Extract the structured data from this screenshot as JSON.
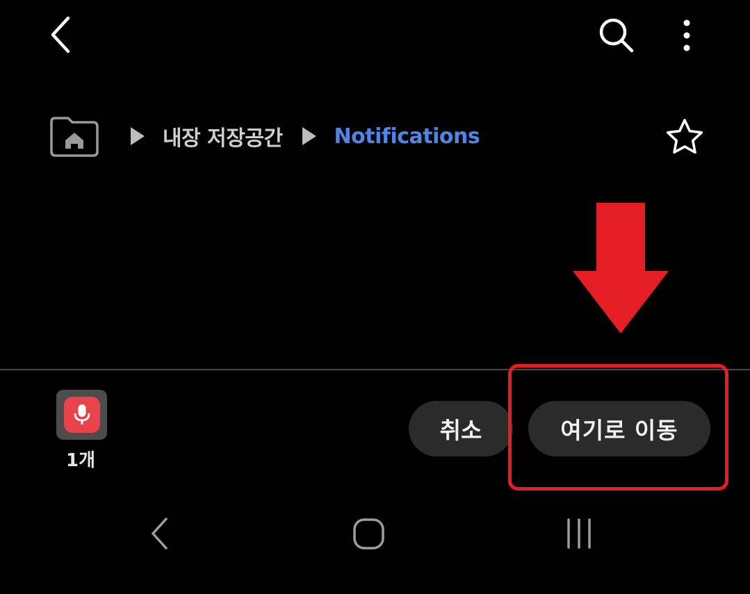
{
  "topbar": {
    "back_icon": "chevron-left-icon",
    "search_icon": "search-icon",
    "more_icon": "more-vertical-icon"
  },
  "breadcrumb": {
    "home_icon": "home-folder-icon",
    "separator_icon": "triangle-right-icon",
    "items": [
      {
        "label": "내장 저장공간"
      },
      {
        "label": "Notifications"
      }
    ],
    "current_color": "#4f86e6",
    "favorite_icon": "star-outline-icon"
  },
  "selection": {
    "file_icon": "voice-recorder-icon",
    "count_label": "1개"
  },
  "actions": {
    "cancel_label": "취소",
    "move_here_label": "여기로 이동"
  },
  "annotations": {
    "arrow_icon": "red-down-arrow",
    "highlight_color": "#e51d24"
  },
  "system_nav": {
    "back_icon": "nav-back-icon",
    "home_icon": "nav-home-icon",
    "recents_icon": "nav-recents-icon"
  }
}
